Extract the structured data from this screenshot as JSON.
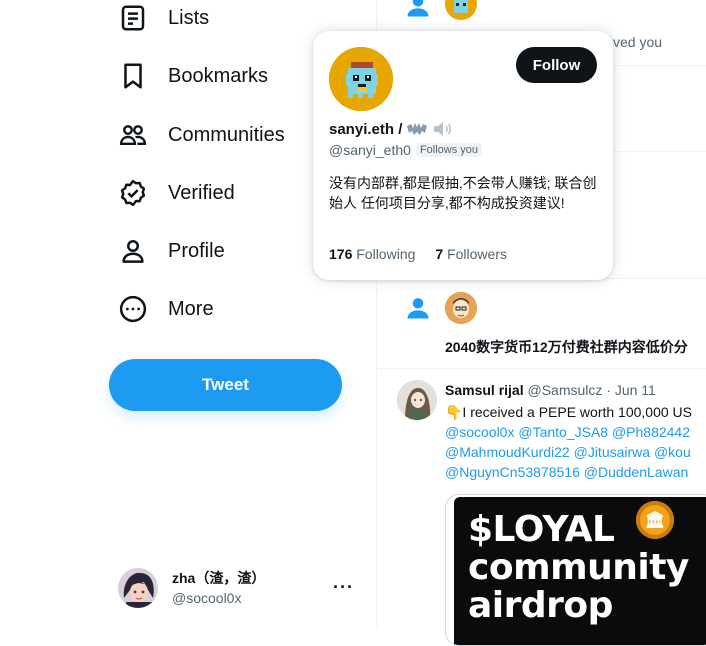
{
  "nav": {
    "items": [
      {
        "label": "Lists",
        "icon": "list-icon"
      },
      {
        "label": "Bookmarks",
        "icon": "bookmark-icon"
      },
      {
        "label": "Communities",
        "icon": "communities-icon"
      },
      {
        "label": "Verified",
        "icon": "verified-icon"
      },
      {
        "label": "Profile",
        "icon": "profile-icon"
      },
      {
        "label": "More",
        "icon": "more-circle-icon"
      }
    ],
    "tweet_button": "Tweet"
  },
  "account": {
    "name": "zha（渣，渣）",
    "handle": "@socool0x",
    "more": "···"
  },
  "hover_card": {
    "name": "sanyi.eth /",
    "handle": "@sanyi_eth0",
    "follows_you": "Follows you",
    "follow_button": "Follow",
    "bio": "没有内部群,都是假抽,不会带人赚钱; 联合创始人 任何项目分享,都不构成投资建议!",
    "following_count": "176",
    "following_label": "Following",
    "followers_count": "7",
    "followers_label": "Followers"
  },
  "timeline": {
    "notification_text": "ved you",
    "promo_heading": "2040数字货币12万付费社群内容低价分",
    "tweet": {
      "author_name": "Samsul rijal",
      "author_handle": "@Samsulcz",
      "separator": "·",
      "date": "Jun 11",
      "text_line": "👇I received a PEPE worth 100,000 US",
      "mentions_line1": "@socool0x @Tanto_JSA8 @Ph882442",
      "mentions_line2": "@MahmoudKurdi22 @Jitusairwa @kou",
      "mentions_line3": "@NguynCn53878516 @DuddenLawan",
      "media_lines": [
        "$LOYAL",
        "community",
        "airdrop"
      ]
    }
  },
  "colors": {
    "accent": "#1d9bf0",
    "text_primary": "#0f1419",
    "text_secondary": "#536471",
    "follow_button": "#0f1419",
    "avatar_bg": "#e6a701"
  }
}
